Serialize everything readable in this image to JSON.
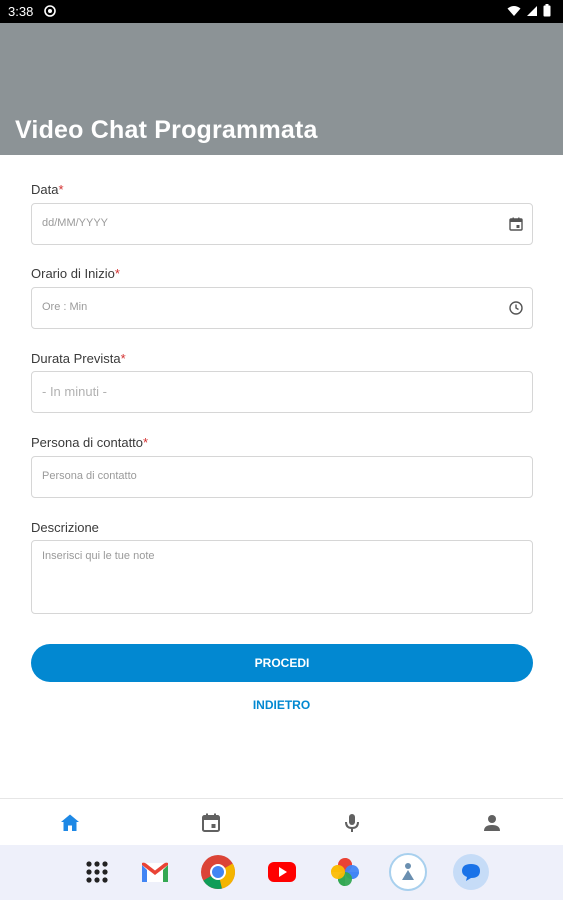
{
  "status_bar": {
    "time": "3:38"
  },
  "header": {
    "title": "Video Chat Programmata"
  },
  "form": {
    "date": {
      "label": "Data",
      "required_mark": "*",
      "placeholder": "dd/MM/YYYY"
    },
    "start_time": {
      "label": "Orario di Inizio",
      "required_mark": "*",
      "placeholder": "Ore : Min"
    },
    "duration": {
      "label": "Durata Prevista",
      "required_mark": "*",
      "placeholder": "- In minuti -"
    },
    "contact": {
      "label": "Persona di contatto",
      "required_mark": "*",
      "placeholder": "Persona di contatto"
    },
    "description": {
      "label": "Descrizione",
      "placeholder": "Inserisci qui le tue note"
    }
  },
  "actions": {
    "proceed_label": "PROCEDI",
    "back_label": "INDIETRO"
  },
  "bottom_nav": {
    "items": [
      {
        "icon": "home-icon",
        "active": true
      },
      {
        "icon": "calendar-icon",
        "active": false
      },
      {
        "icon": "microphone-icon",
        "active": false
      },
      {
        "icon": "person-icon",
        "active": false
      }
    ]
  },
  "dock": {
    "apps": [
      "app-drawer-icon",
      "gmail-icon",
      "chrome-icon",
      "youtube-icon",
      "photos-icon",
      "assistant-app-icon",
      "messages-icon"
    ]
  },
  "colors": {
    "accent": "#0288d1",
    "header": "#8c9396",
    "required": "#d32f2f",
    "nav_active": "#1e88e5",
    "nav_inactive": "#616161"
  }
}
